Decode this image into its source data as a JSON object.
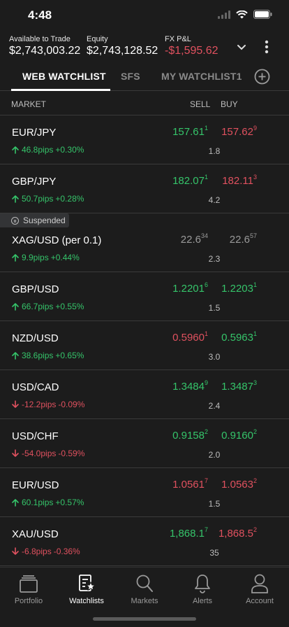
{
  "status_bar": {
    "time": "4:48"
  },
  "account": {
    "available_label": "Available to Trade",
    "available_value": "$2,743,003.22",
    "equity_label": "Equity",
    "equity_value": "$2,743,128.52",
    "pnl_label": "FX P&L",
    "pnl_value": "-$1,595.62"
  },
  "tabs": [
    {
      "label": "WEB WATCHLIST",
      "active": true
    },
    {
      "label": "SFS",
      "active": false
    },
    {
      "label": "MY WATCHLIST1",
      "active": false
    }
  ],
  "list_header": {
    "market": "MARKET",
    "sell": "SELL",
    "buy": "BUY"
  },
  "rows": [
    {
      "pair": "EUR/JPY",
      "dir": "up",
      "pips": "46.8pips",
      "pct": "+0.30%",
      "sell_main": "157.61",
      "sell_sup": "1",
      "sell_color": "green",
      "buy_main": "157.62",
      "buy_sup": "9",
      "buy_color": "red",
      "spread": "1.8"
    },
    {
      "pair": "GBP/JPY",
      "dir": "up",
      "pips": "50.7pips",
      "pct": "+0.28%",
      "sell_main": "182.07",
      "sell_sup": "1",
      "sell_color": "green",
      "buy_main": "182.11",
      "buy_sup": "3",
      "buy_color": "red",
      "spread": "4.2"
    },
    {
      "pair": "XAG/USD (per 0.1)",
      "dir": "up",
      "pips": "9.9pips",
      "pct": "+0.44%",
      "sell_main": "22.6",
      "sell_sup": "34",
      "sell_color": "gray",
      "buy_main": "22.6",
      "buy_sup": "57",
      "buy_color": "gray",
      "spread": "2.3",
      "suspended": "Suspended"
    },
    {
      "pair": "GBP/USD",
      "dir": "up",
      "pips": "66.7pips",
      "pct": "+0.55%",
      "sell_main": "1.2201",
      "sell_sup": "6",
      "sell_color": "green",
      "buy_main": "1.2203",
      "buy_sup": "1",
      "buy_color": "green",
      "spread": "1.5"
    },
    {
      "pair": "NZD/USD",
      "dir": "up",
      "pips": "38.6pips",
      "pct": "+0.65%",
      "sell_main": "0.5960",
      "sell_sup": "1",
      "sell_color": "red",
      "buy_main": "0.5963",
      "buy_sup": "1",
      "buy_color": "green",
      "spread": "3.0"
    },
    {
      "pair": "USD/CAD",
      "dir": "down",
      "pips": "-12.2pips",
      "pct": "-0.09%",
      "sell_main": "1.3484",
      "sell_sup": "9",
      "sell_color": "green",
      "buy_main": "1.3487",
      "buy_sup": "3",
      "buy_color": "green",
      "spread": "2.4"
    },
    {
      "pair": "USD/CHF",
      "dir": "down",
      "pips": "-54.0pips",
      "pct": "-0.59%",
      "sell_main": "0.9158",
      "sell_sup": "2",
      "sell_color": "green",
      "buy_main": "0.9160",
      "buy_sup": "2",
      "buy_color": "green",
      "spread": "2.0"
    },
    {
      "pair": "EUR/USD",
      "dir": "up",
      "pips": "60.1pips",
      "pct": "+0.57%",
      "sell_main": "1.0561",
      "sell_sup": "7",
      "sell_color": "red",
      "buy_main": "1.0563",
      "buy_sup": "2",
      "buy_color": "red",
      "spread": "1.5"
    },
    {
      "pair": "XAU/USD",
      "dir": "down",
      "pips": "-6.8pips",
      "pct": "-0.36%",
      "sell_main": "1,868.1",
      "sell_sup": "7",
      "sell_color": "green",
      "buy_main": "1,868.5",
      "buy_sup": "2",
      "buy_color": "red",
      "spread": "35"
    }
  ],
  "nav": [
    {
      "label": "Portfolio",
      "icon": "portfolio-icon",
      "active": false
    },
    {
      "label": "Watchlists",
      "icon": "watchlists-icon",
      "active": true
    },
    {
      "label": "Markets",
      "icon": "search-icon",
      "active": false
    },
    {
      "label": "Alerts",
      "icon": "bell-icon",
      "active": false
    },
    {
      "label": "Account",
      "icon": "user-icon",
      "active": false
    }
  ],
  "colors": {
    "green": "#35c46a",
    "red": "#e0515f",
    "background": "#1c1c1c"
  }
}
